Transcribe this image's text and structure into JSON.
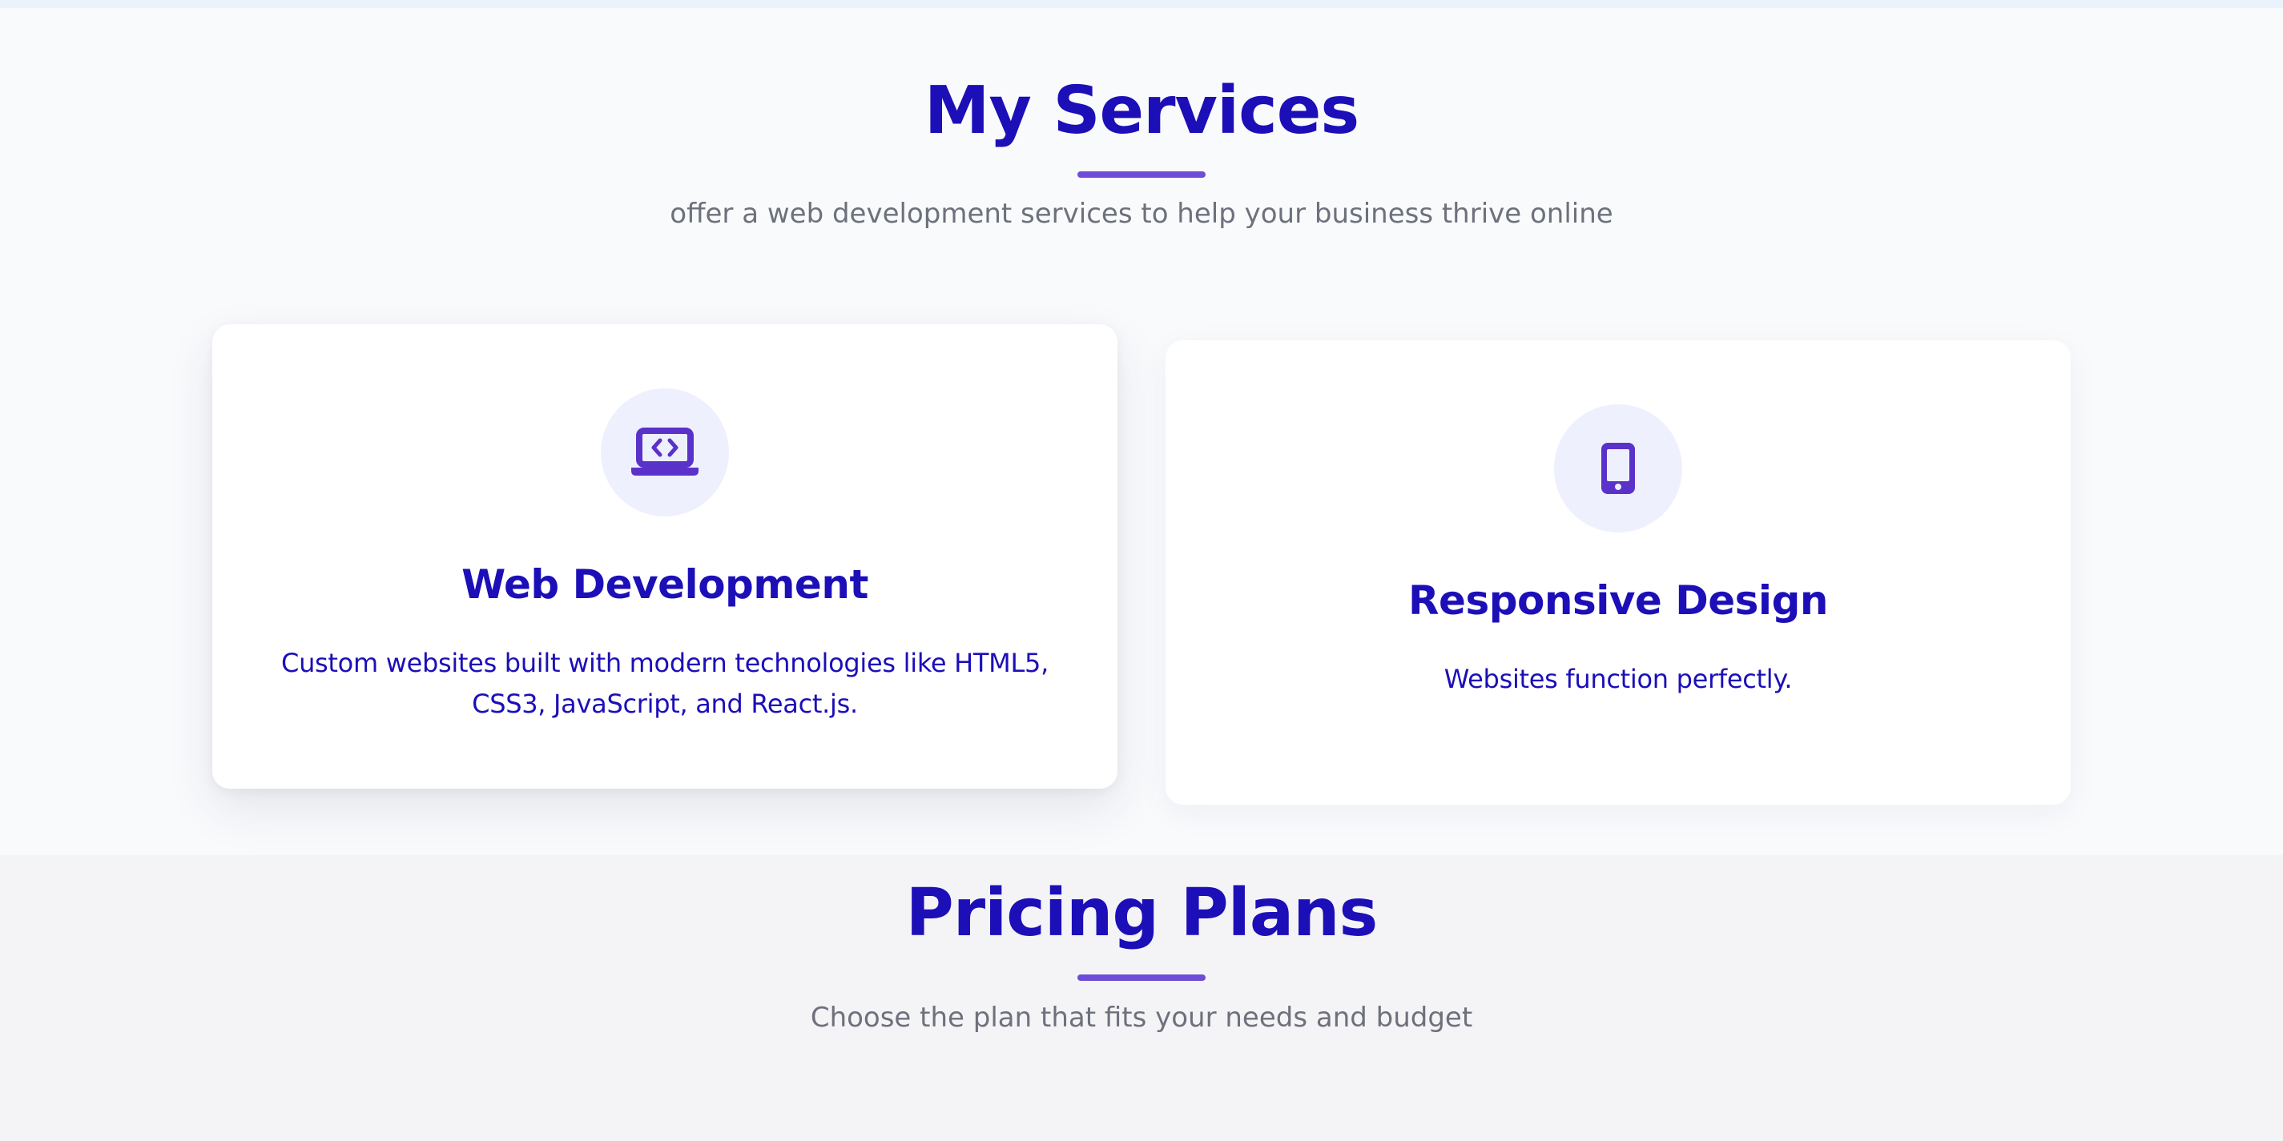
{
  "services": {
    "title": "My Services",
    "subtitle": "offer a web development services to help your business thrive online",
    "cards": [
      {
        "icon": "laptop-code-icon",
        "title": "Web Development",
        "description": "Custom websites built with modern technologies like HTML5, CSS3, JavaScript, and React.js."
      },
      {
        "icon": "mobile-icon",
        "title": "Responsive Design",
        "description": "Websites function perfectly."
      }
    ]
  },
  "pricing": {
    "title": "Pricing Plans",
    "subtitle": "Choose the plan that fits your needs and budget"
  },
  "colors": {
    "heading": "#1c0fb8",
    "accent": "#6e4cd8",
    "muted_text": "#6e717c",
    "icon_bg": "#eef0fd",
    "services_bg": "#f9fafc",
    "pricing_bg": "#f4f4f7"
  }
}
